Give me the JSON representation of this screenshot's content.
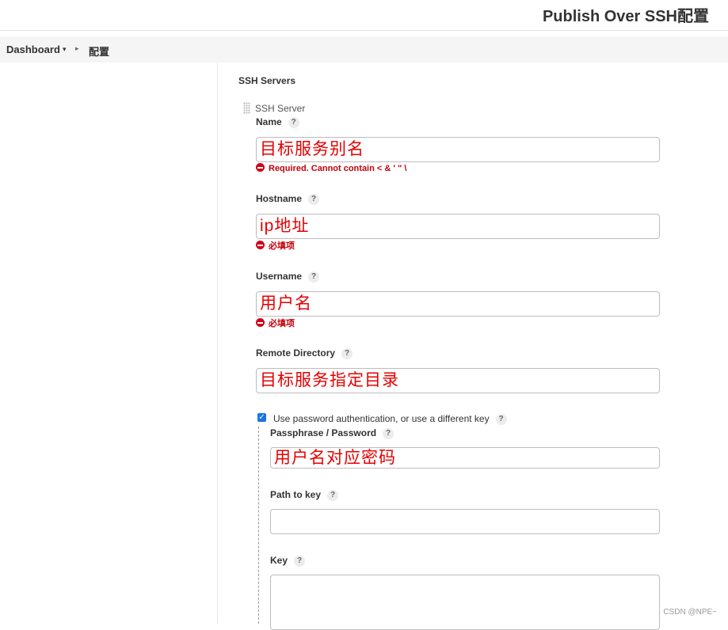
{
  "header": {
    "title": "Publish Over SSH配置"
  },
  "breadcrumb": {
    "items": [
      "Dashboard",
      "配置"
    ],
    "dropdown_caret": "▾",
    "separator": "▸"
  },
  "form": {
    "section_title": "SSH Servers",
    "server_block_title": "SSH Server",
    "help_glyph": "?",
    "fields": {
      "name": {
        "label": "Name",
        "value": "目标服务别名",
        "error": "Required. Cannot contain < & ' \" \\"
      },
      "hostname": {
        "label": "Hostname",
        "value": "ip地址",
        "error": "必填项"
      },
      "username": {
        "label": "Username",
        "value": "用户名",
        "error": "必填项"
      },
      "remote_directory": {
        "label": "Remote Directory",
        "value": "目标服务指定目录"
      }
    },
    "use_password_auth": {
      "checked": true,
      "check_glyph": "✓",
      "label": "Use password authentication, or use a different key"
    },
    "passphrase": {
      "label": "Passphrase / Password",
      "value": "用户名对应密码"
    },
    "path_to_key": {
      "label": "Path to key",
      "value": ""
    },
    "key": {
      "label": "Key",
      "value": ""
    }
  },
  "colors": {
    "annotation": "#e60000",
    "error": "#c4000a",
    "checkbox": "#1a73e8"
  },
  "watermark": "CSDN @NPE~"
}
